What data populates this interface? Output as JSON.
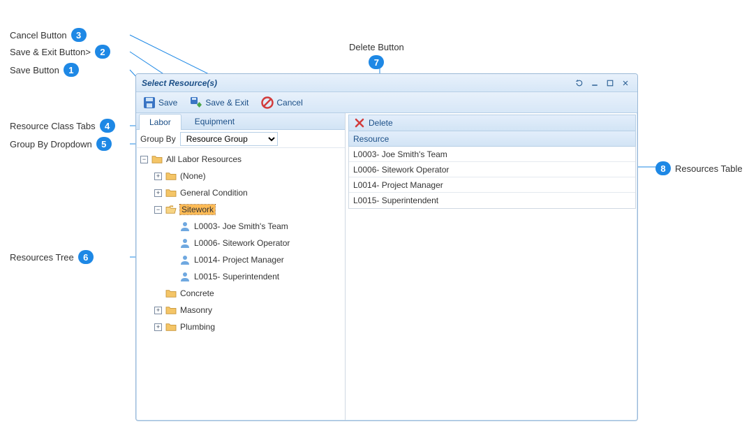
{
  "callouts": {
    "c1": {
      "num": "1",
      "label": "Save Button"
    },
    "c2": {
      "num": "2",
      "label": "Save & Exit Button>"
    },
    "c3": {
      "num": "3",
      "label": "Cancel Button"
    },
    "c4": {
      "num": "4",
      "label": "Resource Class Tabs"
    },
    "c5": {
      "num": "5",
      "label": "Group By Dropdown"
    },
    "c6": {
      "num": "6",
      "label": "Resources Tree"
    },
    "c7": {
      "num": "7",
      "label": "Delete Button"
    },
    "c8": {
      "num": "8",
      "label": "Resources Table"
    }
  },
  "window": {
    "title": "Select Resource(s)"
  },
  "toolbar": {
    "save": "Save",
    "save_exit": "Save & Exit",
    "cancel": "Cancel"
  },
  "tabs": {
    "labor": "Labor",
    "equipment": "Equipment",
    "active": "labor"
  },
  "groupby": {
    "label": "Group By",
    "selected": "Resource Group",
    "options": [
      "Resource Group"
    ]
  },
  "tree": {
    "root": "All Labor Resources",
    "none": "(None)",
    "gencond": "General Condition",
    "sitework": "Sitework",
    "sitework_items": [
      "L0003- Joe Smith's Team",
      "L0006- Sitework Operator",
      "L0014- Project Manager",
      "L0015- Superintendent"
    ],
    "concrete": "Concrete",
    "masonry": "Masonry",
    "plumbing": "Plumbing"
  },
  "right": {
    "delete": "Delete",
    "header": "Resource",
    "rows": [
      "L0003- Joe Smith's Team",
      "L0006- Sitework Operator",
      "L0014- Project Manager",
      "L0015- Superintendent"
    ]
  }
}
